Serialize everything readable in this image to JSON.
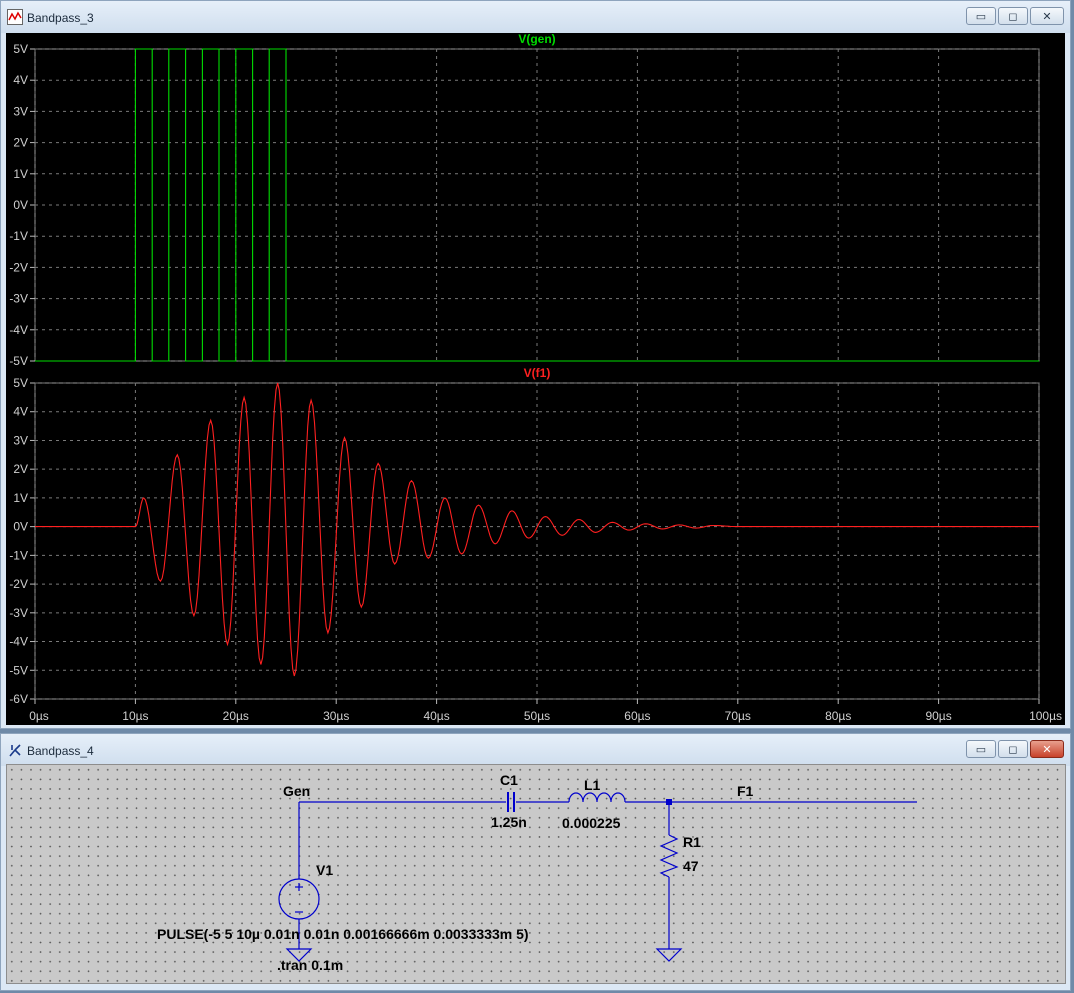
{
  "window_plot": {
    "title": "Bandpass_3",
    "buttons": {
      "minimize": "▭",
      "maximize": "◻",
      "close": "✕"
    }
  },
  "pane_top": {
    "trace_label": "V(gen)",
    "color": "#00dd00",
    "y_ticks": [
      "5V",
      "4V",
      "3V",
      "2V",
      "1V",
      "0V",
      "-1V",
      "-2V",
      "-3V",
      "-4V",
      "-5V"
    ]
  },
  "pane_bottom": {
    "trace_label": "V(f1)",
    "color": "#ff2020",
    "y_ticks": [
      "5V",
      "4V",
      "3V",
      "2V",
      "1V",
      "0V",
      "-1V",
      "-2V",
      "-3V",
      "-4V",
      "-5V",
      "-6V"
    ]
  },
  "x_ticks": [
    "0µs",
    "10µs",
    "20µs",
    "30µs",
    "40µs",
    "50µs",
    "60µs",
    "70µs",
    "80µs",
    "90µs",
    "100µs"
  ],
  "chart_data": [
    {
      "type": "line",
      "title": "V(gen)",
      "xlim": [
        0,
        100
      ],
      "ylim": [
        -5,
        5
      ],
      "grid": true,
      "series": [
        {
          "name": "V(gen)",
          "x": [
            0,
            10,
            10,
            11.67,
            11.67,
            13.33,
            13.33,
            15,
            15,
            16.67,
            16.67,
            18.33,
            18.33,
            20,
            20,
            21.67,
            21.67,
            23.33,
            23.33,
            25,
            25,
            100
          ],
          "y": [
            -5,
            -5,
            5,
            5,
            -5,
            -5,
            5,
            5,
            -5,
            -5,
            5,
            5,
            -5,
            -5,
            5,
            5,
            -5,
            -5,
            5,
            5,
            -5,
            -5
          ]
        }
      ]
    },
    {
      "type": "line",
      "title": "V(f1)",
      "xlim": [
        0,
        100
      ],
      "ylim": [
        -6,
        5
      ],
      "grid": true,
      "series": [
        {
          "name": "V(f1)",
          "x": [
            0,
            10,
            10.83,
            12.5,
            14.17,
            15.83,
            17.5,
            19.17,
            20.83,
            22.5,
            24.17,
            25.83,
            27.5,
            29.17,
            30.83,
            32.5,
            34.17,
            35.83,
            37.5,
            39.17,
            40.83,
            42.5,
            44.17,
            45.83,
            47.5,
            49.17,
            50.83,
            52.5,
            54.17,
            55.83,
            57.5,
            59.17,
            60.83,
            62.5,
            64.17,
            65.83,
            67.5,
            70,
            75,
            80,
            85,
            90,
            100
          ],
          "y": [
            0,
            0,
            1,
            -1.9,
            2.5,
            -3.1,
            3.7,
            -4.1,
            4.5,
            -4.8,
            5,
            -5.2,
            4.4,
            -3.7,
            3.1,
            -2.8,
            2.2,
            -1.3,
            1.6,
            -1.1,
            1,
            -0.95,
            0.75,
            -0.6,
            0.55,
            -0.4,
            0.35,
            -0.3,
            0.25,
            -0.2,
            0.15,
            -0.12,
            0.1,
            -0.08,
            0.06,
            -0.05,
            0.04,
            0,
            0,
            0,
            0,
            0,
            0
          ]
        }
      ]
    }
  ],
  "window_schematic": {
    "title": "Bandpass_4",
    "buttons": {
      "minimize": "▭",
      "maximize": "◻",
      "close": "✕"
    }
  },
  "schematic": {
    "net_gen": "Gen",
    "net_f1": "F1",
    "c1_name": "C1",
    "c1_value": "1.25n",
    "l1_name": "L1",
    "l1_value": "0.000225",
    "r1_name": "R1",
    "r1_value": "47",
    "v1_name": "V1",
    "v1_value": "PULSE(-5 5 10µ 0.01n 0.01n 0.00166666m 0.0033333m 5)",
    "directive": ".tran 0.1m",
    "wire_color": "#0000cc"
  }
}
